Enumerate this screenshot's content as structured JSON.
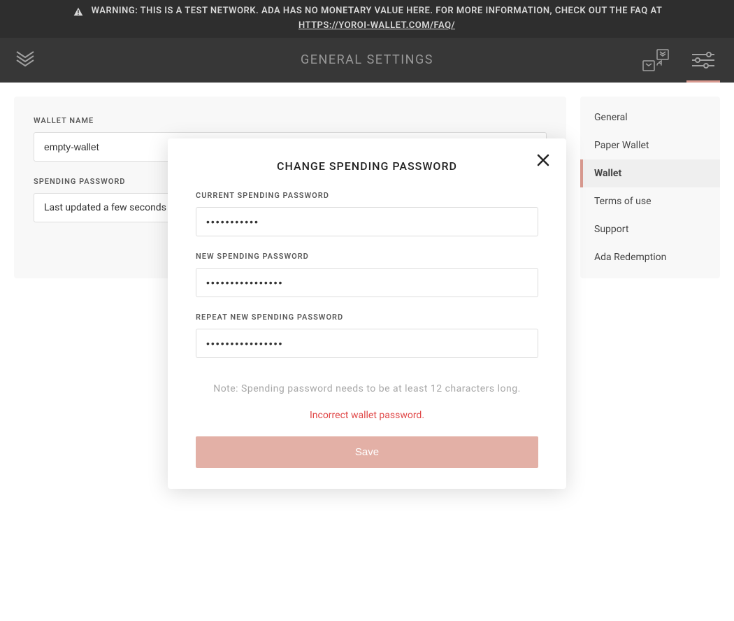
{
  "warning": {
    "text": "WARNING: THIS IS A TEST NETWORK. ADA HAS NO MONETARY VALUE HERE. FOR MORE INFORMATION, CHECK OUT THE FAQ AT",
    "link": "HTTPS://YOROI-WALLET.COM/FAQ/"
  },
  "header": {
    "title": "GENERAL SETTINGS"
  },
  "main": {
    "wallet_name_label": "WALLET NAME",
    "wallet_name_value": "empty-wallet",
    "spending_password_label": "SPENDING PASSWORD",
    "spending_password_status": "Last updated a few seconds ago"
  },
  "sidebar": {
    "items": [
      {
        "label": "General",
        "active": false
      },
      {
        "label": "Paper Wallet",
        "active": false
      },
      {
        "label": "Wallet",
        "active": true
      },
      {
        "label": "Terms of use",
        "active": false
      },
      {
        "label": "Support",
        "active": false
      },
      {
        "label": "Ada Redemption",
        "active": false
      }
    ]
  },
  "modal": {
    "title": "CHANGE SPENDING PASSWORD",
    "current_label": "CURRENT SPENDING PASSWORD",
    "current_value": "•••••••••••",
    "new_label": "NEW SPENDING PASSWORD",
    "new_value": "••••••••••••••••",
    "repeat_label": "REPEAT NEW SPENDING PASSWORD",
    "repeat_value": "••••••••••••••••",
    "note": "Note: Spending password needs to be at least 12 characters long.",
    "error": "Incorrect wallet password.",
    "save": "Save"
  },
  "colors": {
    "accent": "#d8998f",
    "error": "#e04848"
  }
}
